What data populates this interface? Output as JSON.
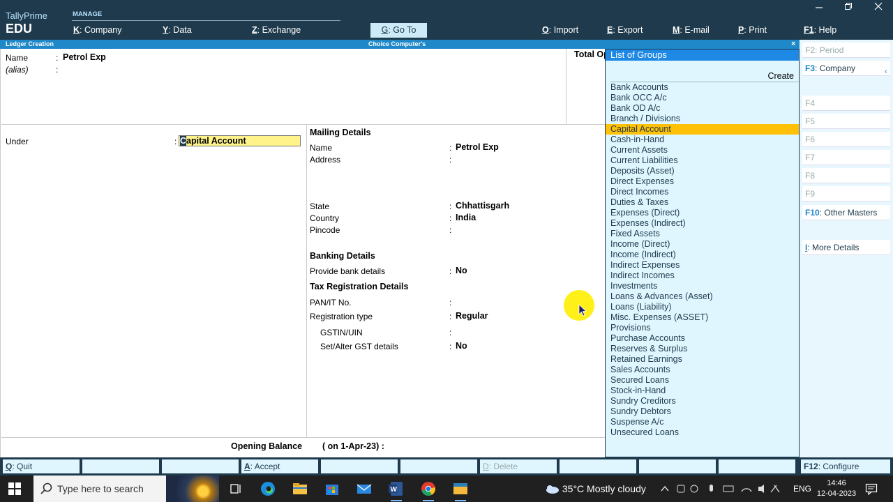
{
  "app": {
    "brand_line1": "TallyPrime",
    "brand_line2": "EDU",
    "manage_label": "MANAGE"
  },
  "topmenu": [
    {
      "key": "K",
      "label": "Company"
    },
    {
      "key": "Y",
      "label": "Data"
    },
    {
      "key": "Z",
      "label": "Exchange"
    },
    {
      "key": "G",
      "label": "Go To"
    },
    {
      "key": "O",
      "label": "Import"
    },
    {
      "key": "E",
      "label": "Export"
    },
    {
      "key": "M",
      "label": "E-mail"
    },
    {
      "key": "P",
      "label": "Print"
    },
    {
      "key": "F1",
      "label": "Help"
    }
  ],
  "titlebar": {
    "left": "Ledger Creation",
    "center": "Choice Computer's",
    "close": "×"
  },
  "form": {
    "name_label": "Name",
    "name_value": "Petrol Exp",
    "alias_label": "(alias)",
    "total_label": "Total Op",
    "under_label": "Under",
    "under_value_first": "C",
    "under_value_rest": "apital Account",
    "mailing_title": "Mailing Details",
    "mail_name_label": "Name",
    "mail_name_value": "Petrol Exp",
    "address_label": "Address",
    "state_label": "State",
    "state_value": "Chhattisgarh",
    "country_label": "Country",
    "country_value": "India",
    "pincode_label": "Pincode",
    "banking_title": "Banking Details",
    "bank_label": "Provide bank details",
    "bank_value": "No",
    "tax_title": "Tax Registration Details",
    "pan_label": "PAN/IT No.",
    "regtype_label": "Registration type",
    "regtype_value": "Regular",
    "gstin_label": "GSTIN/UIN",
    "setalter_label": "Set/Alter GST details",
    "setalter_value": "No",
    "opening_label": "Opening Balance",
    "opening_on": "( on 1-Apr-23)  :",
    "colon": ":"
  },
  "groups": {
    "title": "List of Groups",
    "create": "Create",
    "selected_index": 4,
    "items": [
      "Bank Accounts",
      "Bank OCC A/c",
      "Bank OD A/c",
      "Branch / Divisions",
      "Capital Account",
      "Cash-in-Hand",
      "Current Assets",
      "Current Liabilities",
      "Deposits (Asset)",
      "Direct Expenses",
      "Direct Incomes",
      "Duties & Taxes",
      "Expenses (Direct)",
      "Expenses (Indirect)",
      "Fixed Assets",
      "Income (Direct)",
      "Income (Indirect)",
      "Indirect Expenses",
      "Indirect Incomes",
      "Investments",
      "Loans & Advances (Asset)",
      "Loans (Liability)",
      "Misc. Expenses (ASSET)",
      "Provisions",
      "Purchase Accounts",
      "Reserves & Surplus",
      "Retained Earnings",
      "Sales Accounts",
      "Secured Loans",
      "Stock-in-Hand",
      "Sundry Creditors",
      "Sundry Debtors",
      "Suspense A/c",
      "Unsecured Loans"
    ]
  },
  "rpanel": {
    "f2": {
      "key": "F2",
      "label": "Period"
    },
    "f3": {
      "key": "F3",
      "label": "Company"
    },
    "f4": "F4",
    "f5": "F5",
    "f6": "F6",
    "f7": "F7",
    "f8": "F8",
    "f9": "F9",
    "f10": {
      "key": "F10",
      "label": "Other Masters"
    },
    "i": {
      "key": "I",
      "label": "More Details"
    },
    "chev": "‹"
  },
  "bottombar": {
    "quit": {
      "key": "Q",
      "label": "Quit"
    },
    "accept": {
      "key": "A",
      "label": "Accept"
    },
    "delete": {
      "key": "D",
      "label": "Delete"
    },
    "configure": {
      "key": "F12",
      "label": "Configure"
    }
  },
  "taskbar": {
    "search_placeholder": "Type here to search",
    "weather": "35°C  Mostly cloudy",
    "lang": "ENG",
    "time": "14:46",
    "date": "12-04-2023"
  },
  "colors": {
    "topbar": "#1e3a4c",
    "titlebar": "#1e88c8",
    "selected": "#ffc107",
    "input_bg": "#fff38a",
    "list_bg": "#dff6ff"
  }
}
